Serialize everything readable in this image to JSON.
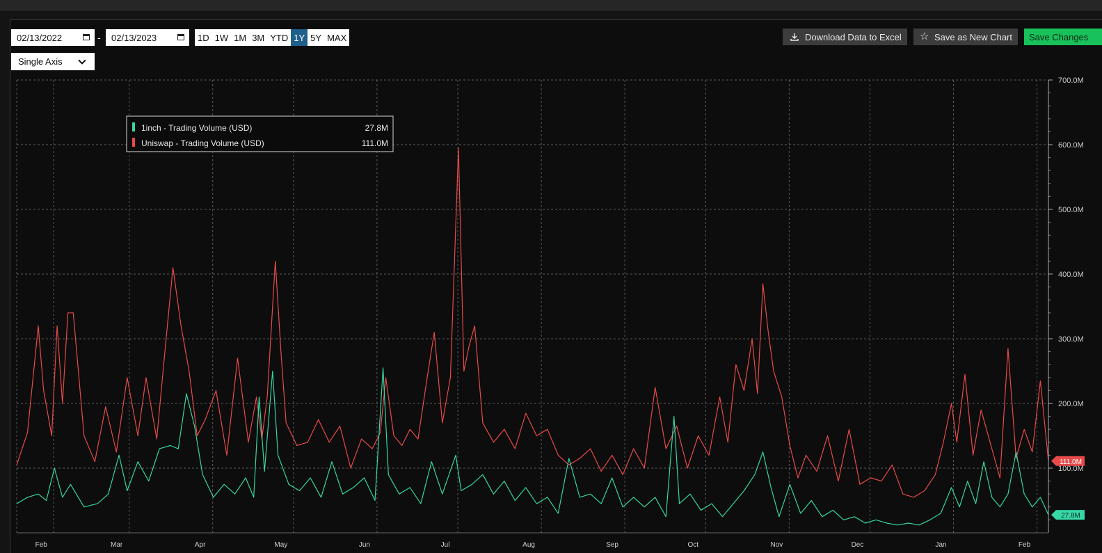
{
  "controls": {
    "start_date": "02/13/2022",
    "end_date": "02/13/2023",
    "separator": "-",
    "ranges": [
      "1D",
      "1W",
      "1M",
      "3M",
      "YTD",
      "1Y",
      "5Y",
      "MAX"
    ],
    "active_range": "1Y",
    "axis_mode": "Single Axis",
    "download_label": "Download Data to Excel",
    "save_new_label": "Save as New Chart",
    "save_changes_label": "Save Changes"
  },
  "colors": {
    "uniswap": "#e84a4a",
    "oneinch": "#36d6a6",
    "accent_active": "#1f5f8b",
    "save_changes": "#19c15a"
  },
  "icons": {
    "download": "download-icon",
    "save": "star-icon",
    "calendar": "calendar-icon"
  },
  "chart_data": {
    "type": "line",
    "title": "",
    "xlabel": "",
    "ylabel": "",
    "x_tick_labels": [
      "Feb",
      "Mar",
      "Apr",
      "May",
      "Jun",
      "Jul",
      "Aug",
      "Sep",
      "Oct",
      "Nov",
      "Dec",
      "Jan",
      "Feb"
    ],
    "x_tick_dates": [
      "2022-02-01",
      "2022-03-01",
      "2022-04-01",
      "2022-05-01",
      "2022-06-01",
      "2022-07-01",
      "2022-08-01",
      "2022-09-01",
      "2022-10-01",
      "2022-11-01",
      "2022-12-01",
      "2023-01-01",
      "2023-02-01"
    ],
    "x_range": [
      "2022-01-26",
      "2023-02-13"
    ],
    "y_ticks": [
      100,
      200,
      300,
      400,
      500,
      600,
      700
    ],
    "y_tick_labels": [
      "100.0M",
      "200.0M",
      "300.0M",
      "400.0M",
      "500.0M",
      "600.0M",
      "700.0M"
    ],
    "ylim": [
      0,
      700
    ],
    "y_unit": "M USD",
    "grid": true,
    "legend": "tooltip top-left",
    "tooltip": {
      "rows": [
        {
          "label": "1inch - Trading Volume (USD)",
          "value": "27.8M",
          "color": "#36d6a6"
        },
        {
          "label": "Uniswap - Trading Volume (USD)",
          "value": "111.0M",
          "color": "#e84a4a"
        }
      ]
    },
    "last_value_labels": {
      "uniswap": "111.0M",
      "oneinch": "27.8M"
    },
    "series": [
      {
        "name": "Uniswap - Trading Volume (USD)",
        "color": "#e84a4a",
        "points": [
          [
            "2022-01-26",
            105
          ],
          [
            "2022-01-30",
            155
          ],
          [
            "2022-02-03",
            320
          ],
          [
            "2022-02-05",
            220
          ],
          [
            "2022-02-08",
            150
          ],
          [
            "2022-02-10",
            320
          ],
          [
            "2022-02-12",
            200
          ],
          [
            "2022-02-14",
            340
          ],
          [
            "2022-02-16",
            340
          ],
          [
            "2022-02-20",
            150
          ],
          [
            "2022-02-24",
            110
          ],
          [
            "2022-02-28",
            195
          ],
          [
            "2022-03-04",
            125
          ],
          [
            "2022-03-08",
            240
          ],
          [
            "2022-03-12",
            150
          ],
          [
            "2022-03-15",
            240
          ],
          [
            "2022-03-19",
            145
          ],
          [
            "2022-03-22",
            280
          ],
          [
            "2022-03-25",
            410
          ],
          [
            "2022-03-28",
            320
          ],
          [
            "2022-03-31",
            250
          ],
          [
            "2022-04-03",
            150
          ],
          [
            "2022-04-06",
            175
          ],
          [
            "2022-04-10",
            220
          ],
          [
            "2022-04-14",
            120
          ],
          [
            "2022-04-18",
            270
          ],
          [
            "2022-04-22",
            140
          ],
          [
            "2022-04-25",
            210
          ],
          [
            "2022-04-27",
            145
          ],
          [
            "2022-04-29",
            210
          ],
          [
            "2022-05-02",
            420
          ],
          [
            "2022-05-04",
            285
          ],
          [
            "2022-05-06",
            170
          ],
          [
            "2022-05-10",
            135
          ],
          [
            "2022-05-14",
            140
          ],
          [
            "2022-05-18",
            175
          ],
          [
            "2022-05-22",
            140
          ],
          [
            "2022-05-26",
            165
          ],
          [
            "2022-05-30",
            100
          ],
          [
            "2022-06-03",
            145
          ],
          [
            "2022-06-07",
            130
          ],
          [
            "2022-06-10",
            155
          ],
          [
            "2022-06-12",
            240
          ],
          [
            "2022-06-15",
            150
          ],
          [
            "2022-06-18",
            135
          ],
          [
            "2022-06-21",
            160
          ],
          [
            "2022-06-24",
            145
          ],
          [
            "2022-06-27",
            230
          ],
          [
            "2022-06-30",
            310
          ],
          [
            "2022-07-03",
            170
          ],
          [
            "2022-07-06",
            240
          ],
          [
            "2022-07-09",
            595
          ],
          [
            "2022-07-11",
            250
          ],
          [
            "2022-07-13",
            290
          ],
          [
            "2022-07-15",
            320
          ],
          [
            "2022-07-18",
            170
          ],
          [
            "2022-07-22",
            140
          ],
          [
            "2022-07-26",
            160
          ],
          [
            "2022-07-30",
            130
          ],
          [
            "2022-08-03",
            185
          ],
          [
            "2022-08-07",
            150
          ],
          [
            "2022-08-11",
            160
          ],
          [
            "2022-08-15",
            120
          ],
          [
            "2022-08-19",
            105
          ],
          [
            "2022-08-23",
            115
          ],
          [
            "2022-08-27",
            130
          ],
          [
            "2022-08-31",
            95
          ],
          [
            "2022-09-04",
            120
          ],
          [
            "2022-09-08",
            90
          ],
          [
            "2022-09-12",
            130
          ],
          [
            "2022-09-16",
            100
          ],
          [
            "2022-09-20",
            225
          ],
          [
            "2022-09-24",
            130
          ],
          [
            "2022-09-28",
            165
          ],
          [
            "2022-10-02",
            100
          ],
          [
            "2022-10-06",
            150
          ],
          [
            "2022-10-10",
            120
          ],
          [
            "2022-10-14",
            210
          ],
          [
            "2022-10-17",
            140
          ],
          [
            "2022-10-20",
            260
          ],
          [
            "2022-10-23",
            220
          ],
          [
            "2022-10-26",
            300
          ],
          [
            "2022-10-28",
            215
          ],
          [
            "2022-10-30",
            385
          ],
          [
            "2022-11-01",
            310
          ],
          [
            "2022-11-03",
            250
          ],
          [
            "2022-11-06",
            210
          ],
          [
            "2022-11-09",
            135
          ],
          [
            "2022-11-12",
            85
          ],
          [
            "2022-11-15",
            120
          ],
          [
            "2022-11-19",
            95
          ],
          [
            "2022-11-23",
            150
          ],
          [
            "2022-11-27",
            80
          ],
          [
            "2022-12-01",
            160
          ],
          [
            "2022-12-05",
            75
          ],
          [
            "2022-12-09",
            85
          ],
          [
            "2022-12-13",
            80
          ],
          [
            "2022-12-17",
            105
          ],
          [
            "2022-12-21",
            60
          ],
          [
            "2022-12-25",
            55
          ],
          [
            "2022-12-29",
            65
          ],
          [
            "2023-01-02",
            90
          ],
          [
            "2023-01-05",
            140
          ],
          [
            "2023-01-08",
            200
          ],
          [
            "2023-01-10",
            140
          ],
          [
            "2023-01-13",
            245
          ],
          [
            "2023-01-16",
            120
          ],
          [
            "2023-01-19",
            190
          ],
          [
            "2023-01-23",
            130
          ],
          [
            "2023-01-26",
            85
          ],
          [
            "2023-01-29",
            285
          ],
          [
            "2023-02-01",
            115
          ],
          [
            "2023-02-04",
            160
          ],
          [
            "2023-02-07",
            125
          ],
          [
            "2023-02-10",
            235
          ],
          [
            "2023-02-13",
            111
          ]
        ]
      },
      {
        "name": "1inch - Trading Volume (USD)",
        "color": "#36d6a6",
        "points": [
          [
            "2022-01-26",
            45
          ],
          [
            "2022-01-30",
            55
          ],
          [
            "2022-02-03",
            60
          ],
          [
            "2022-02-06",
            50
          ],
          [
            "2022-02-09",
            100
          ],
          [
            "2022-02-12",
            55
          ],
          [
            "2022-02-15",
            75
          ],
          [
            "2022-02-20",
            40
          ],
          [
            "2022-02-25",
            45
          ],
          [
            "2022-03-01",
            60
          ],
          [
            "2022-03-05",
            120
          ],
          [
            "2022-03-08",
            65
          ],
          [
            "2022-03-12",
            110
          ],
          [
            "2022-03-16",
            80
          ],
          [
            "2022-03-20",
            130
          ],
          [
            "2022-03-24",
            135
          ],
          [
            "2022-03-27",
            130
          ],
          [
            "2022-03-30",
            215
          ],
          [
            "2022-04-02",
            165
          ],
          [
            "2022-04-05",
            90
          ],
          [
            "2022-04-09",
            55
          ],
          [
            "2022-04-13",
            75
          ],
          [
            "2022-04-17",
            60
          ],
          [
            "2022-04-21",
            85
          ],
          [
            "2022-04-24",
            55
          ],
          [
            "2022-04-26",
            210
          ],
          [
            "2022-04-28",
            95
          ],
          [
            "2022-05-01",
            250
          ],
          [
            "2022-05-03",
            120
          ],
          [
            "2022-05-07",
            75
          ],
          [
            "2022-05-11",
            65
          ],
          [
            "2022-05-15",
            85
          ],
          [
            "2022-05-19",
            55
          ],
          [
            "2022-05-23",
            110
          ],
          [
            "2022-05-27",
            60
          ],
          [
            "2022-05-31",
            70
          ],
          [
            "2022-06-04",
            85
          ],
          [
            "2022-06-08",
            50
          ],
          [
            "2022-06-11",
            255
          ],
          [
            "2022-06-13",
            90
          ],
          [
            "2022-06-17",
            60
          ],
          [
            "2022-06-21",
            70
          ],
          [
            "2022-06-25",
            45
          ],
          [
            "2022-06-29",
            110
          ],
          [
            "2022-07-03",
            60
          ],
          [
            "2022-07-08",
            120
          ],
          [
            "2022-07-10",
            65
          ],
          [
            "2022-07-14",
            75
          ],
          [
            "2022-07-18",
            90
          ],
          [
            "2022-07-22",
            60
          ],
          [
            "2022-07-26",
            80
          ],
          [
            "2022-07-30",
            50
          ],
          [
            "2022-08-03",
            70
          ],
          [
            "2022-08-07",
            45
          ],
          [
            "2022-08-11",
            55
          ],
          [
            "2022-08-15",
            30
          ],
          [
            "2022-08-19",
            115
          ],
          [
            "2022-08-23",
            55
          ],
          [
            "2022-08-27",
            60
          ],
          [
            "2022-08-31",
            45
          ],
          [
            "2022-09-04",
            85
          ],
          [
            "2022-09-08",
            40
          ],
          [
            "2022-09-12",
            55
          ],
          [
            "2022-09-16",
            40
          ],
          [
            "2022-09-20",
            55
          ],
          [
            "2022-09-24",
            25
          ],
          [
            "2022-09-27",
            180
          ],
          [
            "2022-09-29",
            45
          ],
          [
            "2022-10-03",
            60
          ],
          [
            "2022-10-07",
            35
          ],
          [
            "2022-10-11",
            45
          ],
          [
            "2022-10-15",
            25
          ],
          [
            "2022-10-19",
            45
          ],
          [
            "2022-10-23",
            65
          ],
          [
            "2022-10-27",
            90
          ],
          [
            "2022-10-30",
            125
          ],
          [
            "2022-11-02",
            70
          ],
          [
            "2022-11-05",
            25
          ],
          [
            "2022-11-09",
            75
          ],
          [
            "2022-11-13",
            30
          ],
          [
            "2022-11-17",
            50
          ],
          [
            "2022-11-21",
            25
          ],
          [
            "2022-11-25",
            35
          ],
          [
            "2022-11-29",
            20
          ],
          [
            "2022-12-03",
            25
          ],
          [
            "2022-12-07",
            15
          ],
          [
            "2022-12-11",
            20
          ],
          [
            "2022-12-15",
            15
          ],
          [
            "2022-12-19",
            12
          ],
          [
            "2022-12-23",
            15
          ],
          [
            "2022-12-27",
            12
          ],
          [
            "2022-12-31",
            20
          ],
          [
            "2023-01-04",
            30
          ],
          [
            "2023-01-08",
            70
          ],
          [
            "2023-01-11",
            40
          ],
          [
            "2023-01-14",
            80
          ],
          [
            "2023-01-17",
            45
          ],
          [
            "2023-01-20",
            110
          ],
          [
            "2023-01-23",
            55
          ],
          [
            "2023-01-26",
            40
          ],
          [
            "2023-01-29",
            60
          ],
          [
            "2023-02-01",
            125
          ],
          [
            "2023-02-04",
            60
          ],
          [
            "2023-02-07",
            40
          ],
          [
            "2023-02-10",
            55
          ],
          [
            "2023-02-13",
            27.8
          ]
        ]
      }
    ]
  }
}
